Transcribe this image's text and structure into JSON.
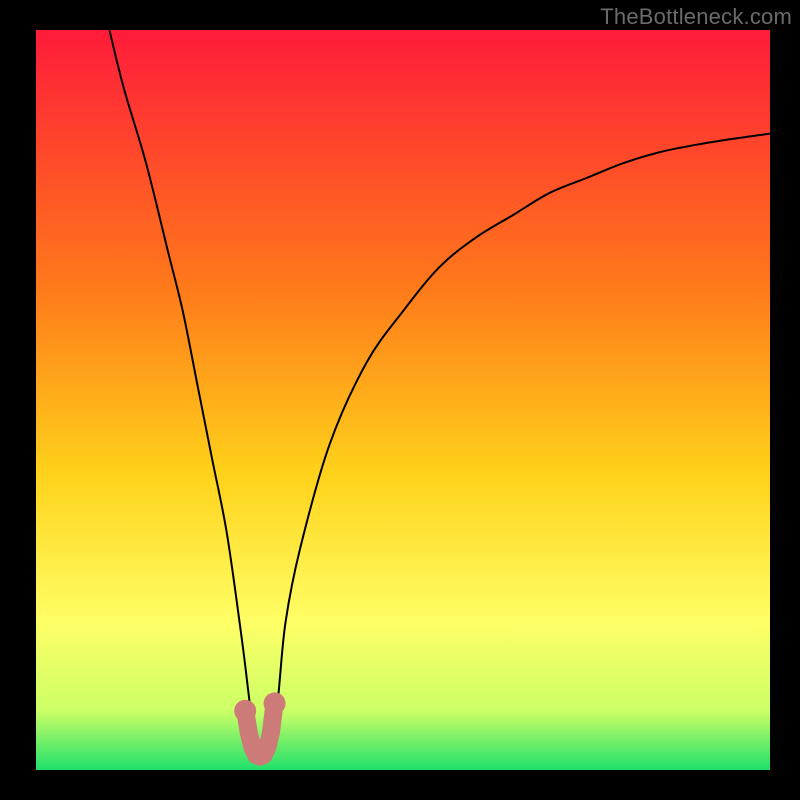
{
  "watermark": "TheBottleneck.com",
  "colors": {
    "frame": "#000000",
    "gradient_top": "#ff1b3a",
    "gradient_mid1": "#ff7a1a",
    "gradient_mid2": "#ffd21a",
    "gradient_mid3": "#ffff66",
    "gradient_mid4": "#ccff66",
    "gradient_bottom": "#1fe06a",
    "curve": "#000000",
    "marker_fill": "#cd7b78",
    "marker_stroke": "#cd7b78"
  },
  "chart_data": {
    "type": "line",
    "title": "",
    "xlabel": "",
    "ylabel": "",
    "ylim": [
      0,
      100
    ],
    "xlim": [
      0,
      100
    ],
    "series": [
      {
        "name": "bottleneck-curve",
        "x": [
          10,
          12,
          15,
          18,
          20,
          22,
          24,
          26,
          28,
          29,
          30,
          31,
          32,
          33,
          34,
          36,
          40,
          45,
          50,
          55,
          60,
          65,
          70,
          75,
          80,
          85,
          90,
          95,
          100
        ],
        "values": [
          100,
          92,
          82,
          70,
          62,
          52,
          42,
          32,
          18,
          10,
          2,
          2,
          2,
          10,
          20,
          30,
          44,
          55,
          62,
          68,
          72,
          75,
          78,
          80,
          82,
          83.5,
          84.5,
          85.3,
          86
        ]
      }
    ],
    "markers": {
      "name": "highlighted-range",
      "x": [
        28.5,
        29.0,
        29.5,
        30.0,
        30.5,
        31.0,
        31.5,
        32.0,
        32.5
      ],
      "values": [
        8.0,
        5.0,
        3.0,
        2.0,
        1.8,
        2.0,
        3.0,
        5.0,
        9.0
      ]
    }
  }
}
